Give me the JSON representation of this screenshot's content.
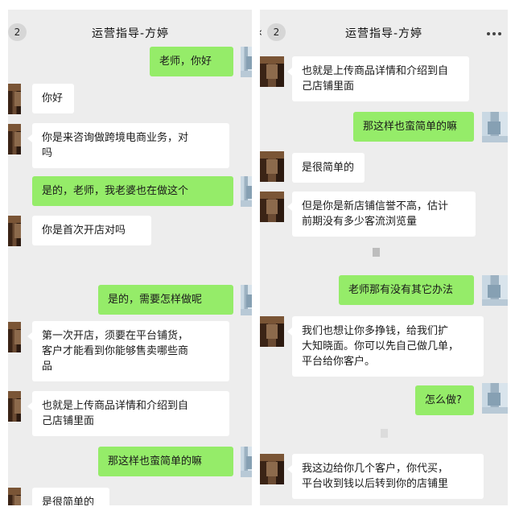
{
  "left_panel": {
    "badge": "2",
    "title": "运营指导-方婷",
    "messages": [
      {
        "sender": "me",
        "text": "老师，你好"
      },
      {
        "sender": "teacher",
        "text": "你好"
      },
      {
        "sender": "teacher",
        "lines": [
          "你是来咨询做跨境电商业务，对",
          "吗"
        ]
      },
      {
        "sender": "me",
        "text": "是的，老师，我老婆也在做这个"
      },
      {
        "sender": "teacher",
        "text": "你是首次开店对吗"
      },
      {
        "sender": "me",
        "text": "是的，需要怎样做呢"
      },
      {
        "sender": "teacher",
        "lines": [
          "第一次开店，须要在平台铺货，",
          "客户才能看到你能够售卖哪些商",
          "品"
        ]
      },
      {
        "sender": "teacher",
        "lines": [
          "也就是上传商品详情和介绍到自",
          "己店铺里面"
        ]
      },
      {
        "sender": "me",
        "text": "那这样也蛮简单的嘛"
      },
      {
        "sender": "teacher",
        "text": "是很简单的"
      }
    ]
  },
  "right_panel": {
    "back_icon": "chevron-left-icon",
    "badge": "2",
    "title": "运营指导-方婷",
    "more_icon": "more-dots-icon",
    "messages": [
      {
        "sender": "teacher",
        "lines": [
          "也就是上传商品详情和介绍到自",
          "己店铺里面"
        ]
      },
      {
        "sender": "me",
        "text": "那这样也蛮简单的嘛"
      },
      {
        "sender": "teacher",
        "text": "是很简单的"
      },
      {
        "sender": "teacher",
        "lines": [
          "但是你是新店铺信誉不高，估计",
          "前期没有多少客流浏览量"
        ]
      },
      {
        "sender": "me",
        "text": "老师那有没有其它办法"
      },
      {
        "sender": "teacher",
        "lines": [
          "我们也想让你多挣钱，给我们扩",
          "大知晓面。你可以先自己做几单，",
          "平台给你客户。"
        ]
      },
      {
        "sender": "me",
        "text": "怎么做?"
      },
      {
        "sender": "teacher",
        "lines": [
          "我这边给你几个客户，你代买，",
          "平台收到钱以后转到你的店铺里"
        ]
      }
    ]
  },
  "colors": {
    "chat_background": "#ededed",
    "outgoing_bubble": "#95ec69",
    "incoming_bubble": "#ffffff",
    "badge": "#d6d6d6"
  }
}
